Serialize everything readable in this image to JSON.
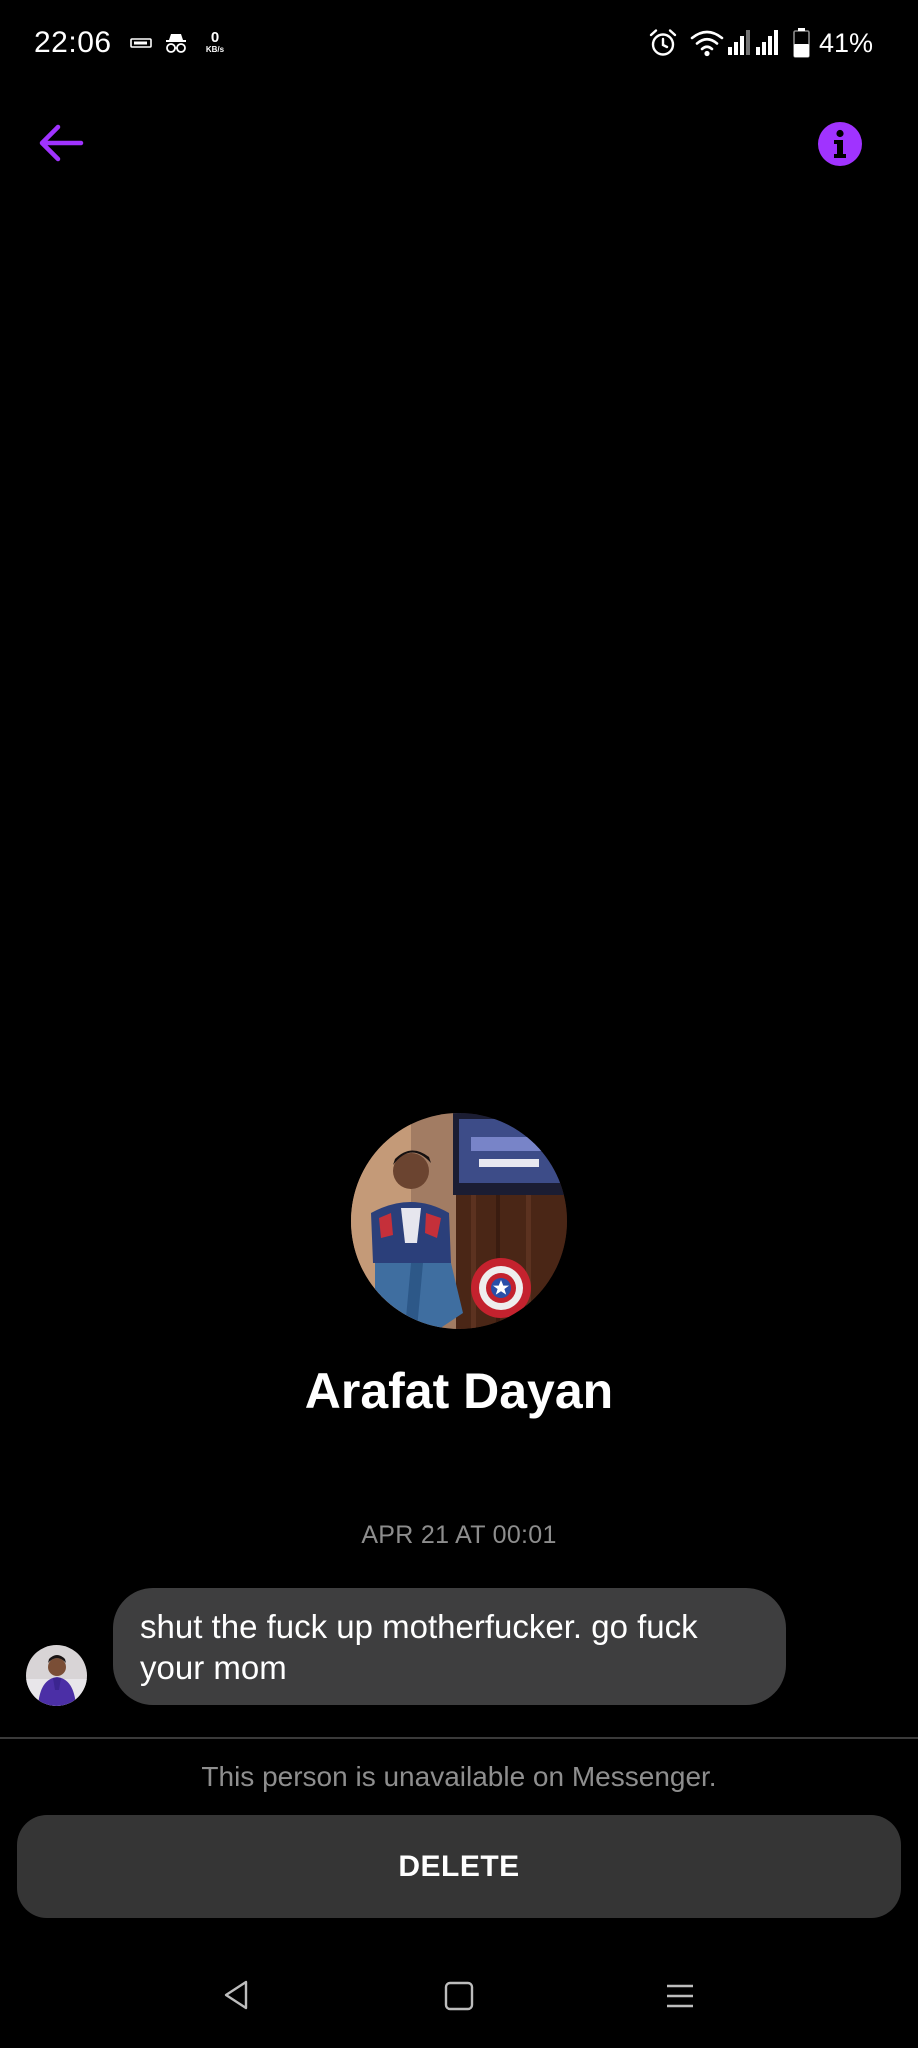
{
  "status_bar": {
    "time": "22:06",
    "net_speed_value": "0",
    "net_speed_unit": "KB/s",
    "battery_percent": "41%",
    "icons": [
      "data-saver-icon",
      "incognito-icon",
      "alarm-icon",
      "wifi-icon",
      "signal-1-icon",
      "signal-2-icon",
      "battery-icon"
    ]
  },
  "header": {
    "back_icon": "arrow-left-icon",
    "info_icon": "info-icon",
    "accent_color": "#a033ff"
  },
  "profile": {
    "name": "Arafat Dayan"
  },
  "conversation": {
    "timestamp": "APR 21 AT 00:01",
    "messages": [
      {
        "text": "shut the fuck up motherfucker. go fuck your mom",
        "incoming": true
      }
    ]
  },
  "footer": {
    "unavailable_notice": "This person is unavailable on Messenger.",
    "delete_label": "DELETE"
  },
  "nav_bar": {
    "icons": [
      "back-triangle-icon",
      "home-square-icon",
      "recents-menu-icon"
    ]
  }
}
